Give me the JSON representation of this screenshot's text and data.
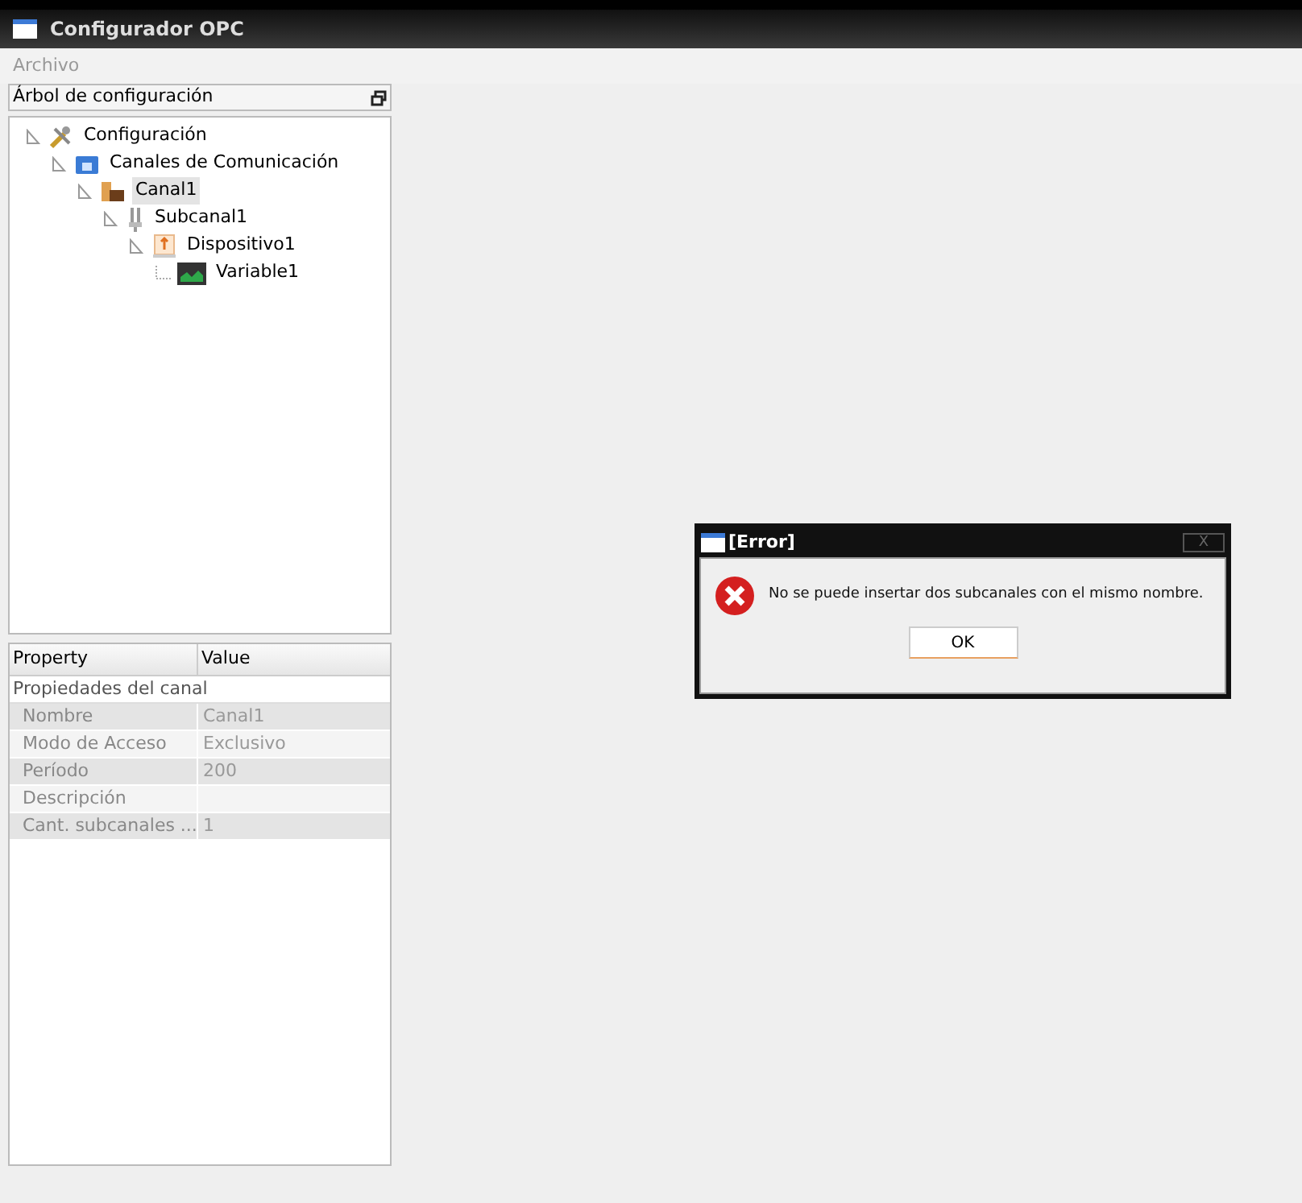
{
  "window": {
    "title": "Configurador OPC"
  },
  "menu": [
    "Archivo"
  ],
  "tree_panel": {
    "title": "Árbol de configuración",
    "tree": [
      {
        "label": "Configuración",
        "kind": "tools",
        "selected": false,
        "children": [
          {
            "label": "Canales de Comunicación",
            "kind": "folder",
            "selected": false,
            "children": [
              {
                "label": "Canal1",
                "kind": "channel",
                "selected": true,
                "children": [
                  {
                    "label": "Subcanal1",
                    "kind": "subchannel",
                    "selected": false,
                    "children": [
                      {
                        "label": "Dispositivo1",
                        "kind": "device",
                        "selected": false,
                        "children": [
                          {
                            "label": "Variable1",
                            "kind": "variable",
                            "selected": false
                          }
                        ]
                      }
                    ]
                  }
                ]
              }
            ]
          }
        ]
      }
    ]
  },
  "properties": {
    "columns": [
      "Property",
      "Value"
    ],
    "group": "Propiedades del canal",
    "rows": [
      {
        "name": "Nombre",
        "value": "Canal1"
      },
      {
        "name": "Modo de Acceso",
        "value": "Exclusivo"
      },
      {
        "name": "Período",
        "value": "200"
      },
      {
        "name": "Descripción"
      },
      {
        "name": "Cant. subcanales ...",
        "value": "1"
      }
    ]
  },
  "dialog": {
    "title": "[Error]",
    "close": "X",
    "message": "No se puede insertar dos subcanales con el mismo nombre.",
    "button": "OK"
  }
}
